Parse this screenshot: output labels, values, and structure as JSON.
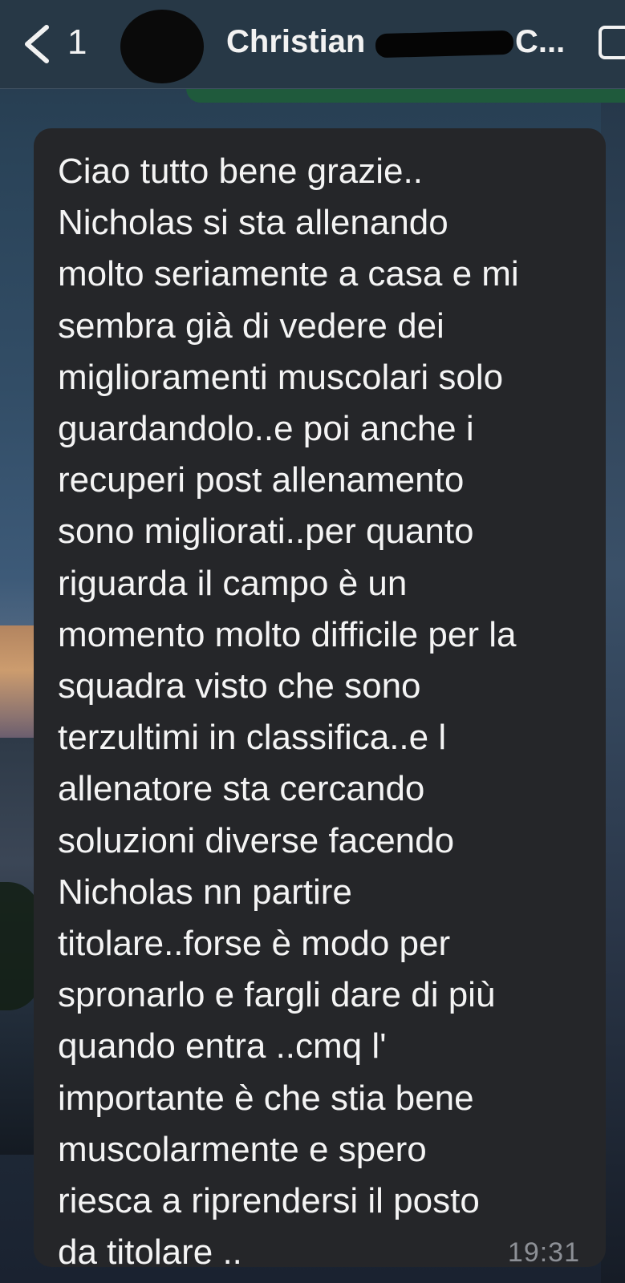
{
  "header": {
    "back_count": "1",
    "contact_name_visible_start": "Christian ",
    "contact_name_visible_end": "C...",
    "back_icon": "chevron-left-icon",
    "call_icon": "video-call-icon"
  },
  "message": {
    "text": "Ciao tutto bene grazie..\nNicholas si sta allenando\nmolto seriamente a casa e mi\nsembra già di vedere dei\nmiglioramenti muscolari solo\nguardandolo..e poi anche i\nrecuperi post allenamento\nsono migliorati..per quanto\nriguarda il campo è un\nmomento molto difficile per la\nsquadra visto che sono\nterzultimi in classifica..e l\nallenatore sta cercando\nsoluzioni diverse facendo\nNicholas nn partire\ntitolare..forse è modo per\nspronarlo e fargli dare di più\nquando entra ..cmq l'\nimportante è che stia bene\nmuscolarmente e spero\nriesca a riprendersi il posto\nda titolare ..",
    "time": "19:31"
  },
  "colors": {
    "bubble_incoming": "#252629",
    "header_bg": "#283846",
    "text": "#f4f4f4",
    "timestamp": "#8d9096",
    "outgoing_bubble": "#1f5a3c"
  }
}
